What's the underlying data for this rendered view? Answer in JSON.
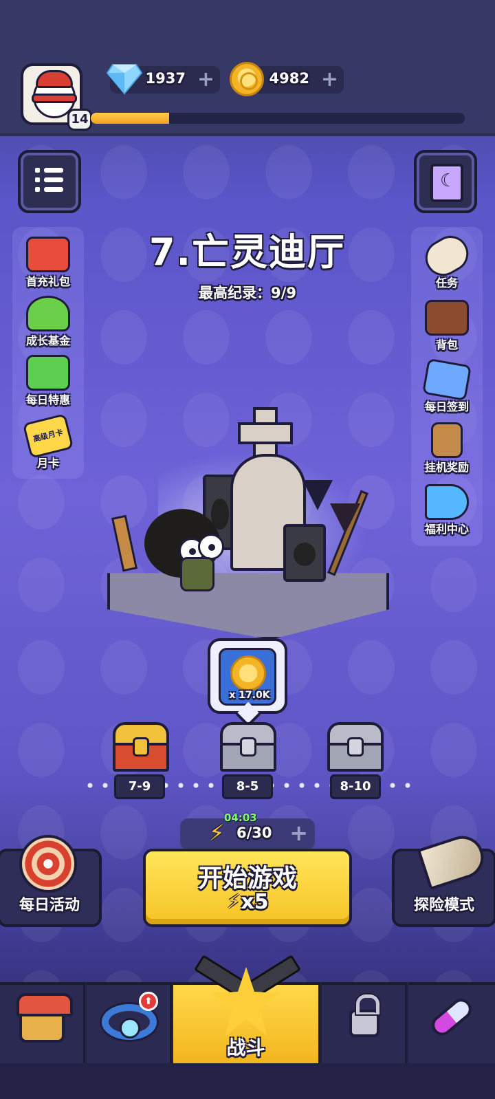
{
  "player": {
    "level": "14",
    "xp_progress": 0.21
  },
  "currencies": {
    "gems": "1937",
    "coins": "4982"
  },
  "stage": {
    "title": "7.亡灵迪厅",
    "best_record": "最高纪录：9/9"
  },
  "left_menu": [
    {
      "label": "首充礼包",
      "icon": "gift-pack-icon",
      "color": "#e74c3c"
    },
    {
      "label": "成长基金",
      "icon": "growth-fund-icon",
      "color": "#6bcf4a"
    },
    {
      "label": "每日特惠",
      "icon": "shopping-basket-icon",
      "color": "#5ccf50"
    },
    {
      "label": "月卡",
      "icon": "monthly-card-icon",
      "badge": "高级月卡",
      "color": "#ffd84a"
    }
  ],
  "right_menu": [
    {
      "label": "任务",
      "icon": "scroll-icon",
      "color": "#f0e6d2"
    },
    {
      "label": "背包",
      "icon": "backpack-icon",
      "color": "#8a4b2e"
    },
    {
      "label": "每日签到",
      "icon": "clipboard-check-icon",
      "color": "#6fa8ff"
    },
    {
      "label": "挂机奖励",
      "icon": "hourglass-icon",
      "color": "#c38a4a"
    },
    {
      "label": "福利中心",
      "icon": "megaphone-icon",
      "color": "#58b8ff"
    }
  ],
  "reward": {
    "quantity": "x 17.0K",
    "icon": "coin-icon"
  },
  "chests": [
    {
      "label": "7-9",
      "type": "gold"
    },
    {
      "label": "8-5",
      "type": "silver"
    },
    {
      "label": "8-10",
      "type": "silver"
    }
  ],
  "energy": {
    "timer": "04:03",
    "value": "6/30"
  },
  "start_button": {
    "label": "开始游戏",
    "cost": "x5"
  },
  "daily_activity": {
    "label": "每日活动"
  },
  "adventure_mode": {
    "label": "探险模式"
  },
  "bottom_nav": {
    "battle_label": "战斗"
  },
  "colors": {
    "accent_yellow": "#ffd84a",
    "background_purple": "#6f62d8",
    "topbar": "#363966"
  }
}
